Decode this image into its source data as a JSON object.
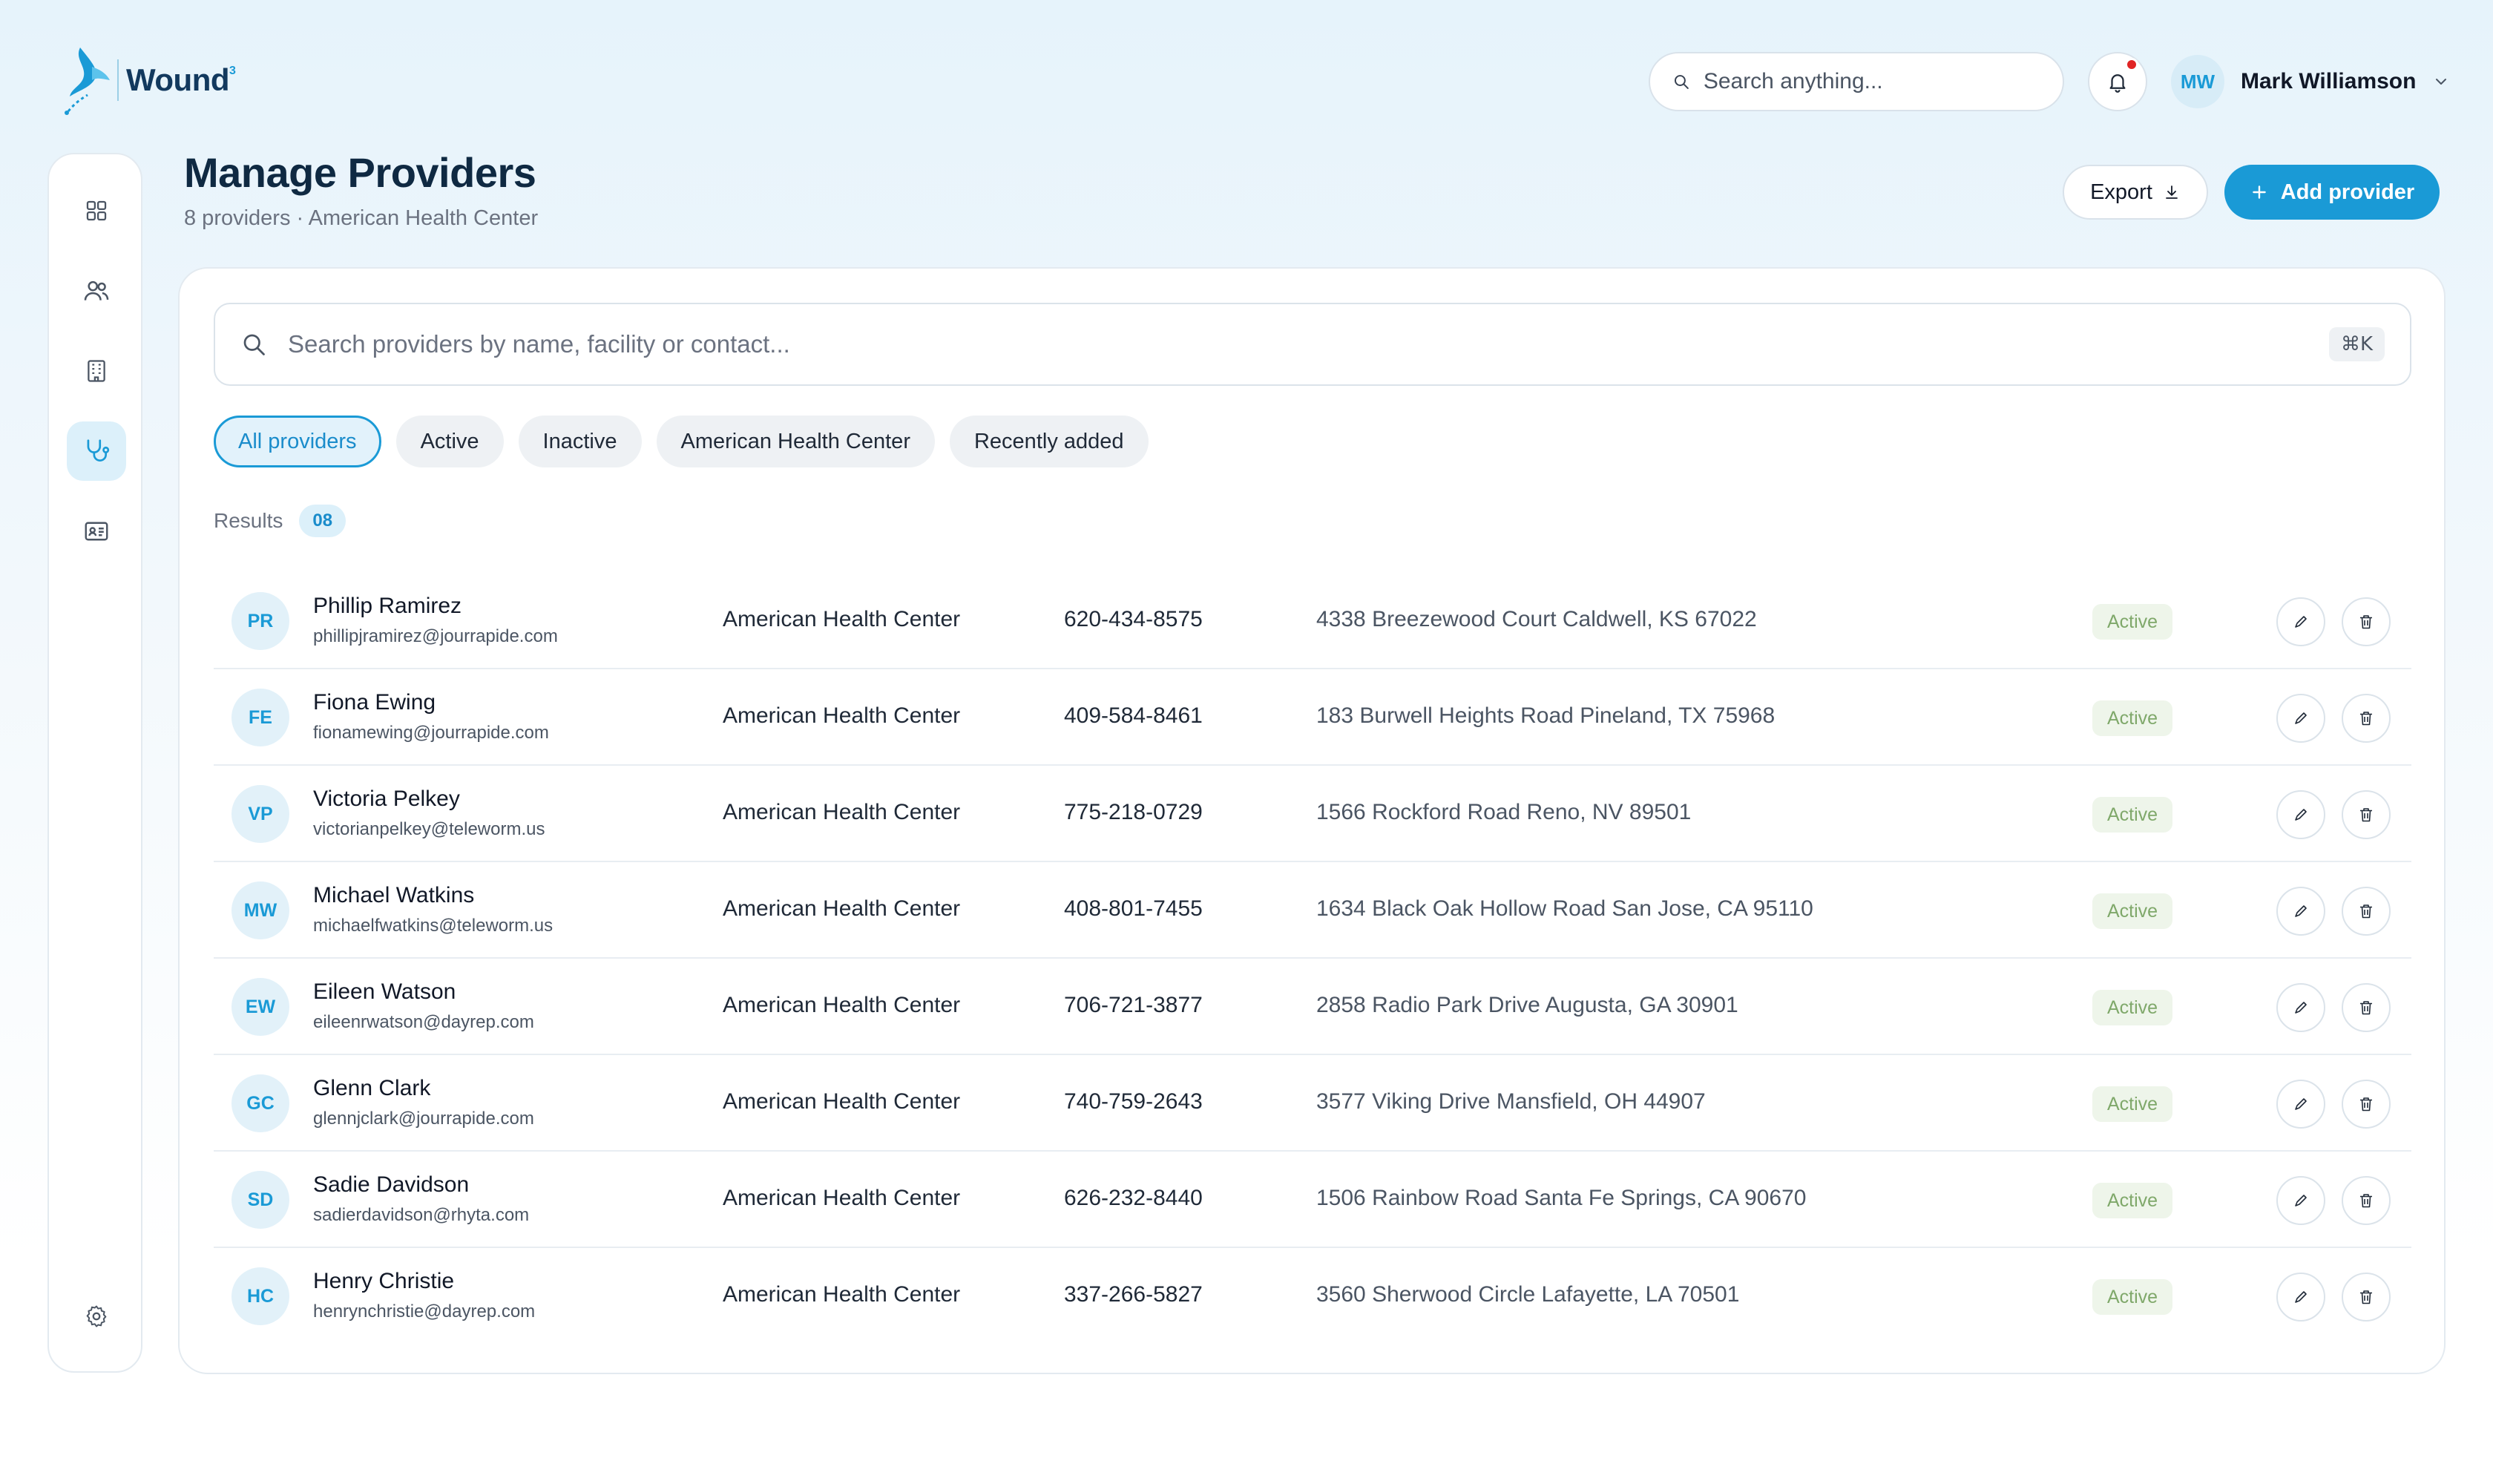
{
  "app": {
    "brand": "Wound",
    "brand_sup": "3"
  },
  "header": {
    "search_placeholder": "Search anything...",
    "user_initials": "MW",
    "user_name": "Mark Williamson",
    "notification_dot_color": "#e02424"
  },
  "sidebar": {
    "items": [
      {
        "icon": "grid-icon",
        "active": false
      },
      {
        "icon": "users-icon",
        "active": false
      },
      {
        "icon": "building-icon",
        "active": false
      },
      {
        "icon": "stethoscope-icon",
        "active": true
      },
      {
        "icon": "id-card-icon",
        "active": false
      }
    ],
    "settings_icon": "gear-icon"
  },
  "page": {
    "title": "Manage Providers",
    "subtitle": "8 providers · American Health Center",
    "export_label": "Export",
    "add_label": "Add provider"
  },
  "main": {
    "search_placeholder": "Search providers by name, facility or contact...",
    "shortcut": "⌘K",
    "filters": [
      "All providers",
      "Active",
      "Inactive",
      "American Health Center",
      "Recently added"
    ],
    "active_filter": "All providers",
    "results_label": "Results",
    "results_count": "08"
  },
  "providers": [
    {
      "initials": "PR",
      "name": "Phillip Ramirez",
      "email": "phillipjramirez@jourrapide.com",
      "facility": "American Health Center",
      "phone": "620-434-8575",
      "address": "4338 Breezewood Court Caldwell, KS 67022",
      "status": "Active"
    },
    {
      "initials": "FE",
      "name": "Fiona Ewing",
      "email": "fionamewing@jourrapide.com",
      "facility": "American Health Center",
      "phone": "409-584-8461",
      "address": "183 Burwell Heights Road Pineland, TX 75968",
      "status": "Active"
    },
    {
      "initials": "VP",
      "name": "Victoria Pelkey",
      "email": "victorianpelkey@teleworm.us",
      "facility": "American Health Center",
      "phone": "775-218-0729",
      "address": "1566 Rockford Road Reno, NV 89501",
      "status": "Active"
    },
    {
      "initials": "MW",
      "name": "Michael Watkins",
      "email": "michaelfwatkins@teleworm.us",
      "facility": "American Health Center",
      "phone": "408-801-7455",
      "address": "1634 Black Oak Hollow Road San Jose, CA 95110",
      "status": "Active"
    },
    {
      "initials": "EW",
      "name": "Eileen Watson",
      "email": "eileenrwatson@dayrep.com",
      "facility": "American Health Center",
      "phone": "706-721-3877",
      "address": "2858 Radio Park Drive Augusta, GA 30901",
      "status": "Active"
    },
    {
      "initials": "GC",
      "name": "Glenn Clark",
      "email": "glennjclark@jourrapide.com",
      "facility": "American Health Center",
      "phone": "740-759-2643",
      "address": "3577 Viking Drive Mansfield, OH 44907",
      "status": "Active"
    },
    {
      "initials": "SD",
      "name": "Sadie Davidson",
      "email": "sadierdavidson@rhyta.com",
      "facility": "American Health Center",
      "phone": "626-232-8440",
      "address": "1506 Rainbow Road Santa Fe Springs, CA 90670",
      "status": "Active"
    },
    {
      "initials": "HC",
      "name": "Henry Christie",
      "email": "henrynchristie@dayrep.com",
      "facility": "American Health Center",
      "phone": "337-266-5827",
      "address": "3560 Sherwood Circle Lafayette, LA 70501",
      "status": "Active"
    }
  ],
  "colors": {
    "accent": "#1a9ad6",
    "title": "#0f2942",
    "status_active_bg": "#eef5ea",
    "status_active_text": "#7fa86a"
  }
}
